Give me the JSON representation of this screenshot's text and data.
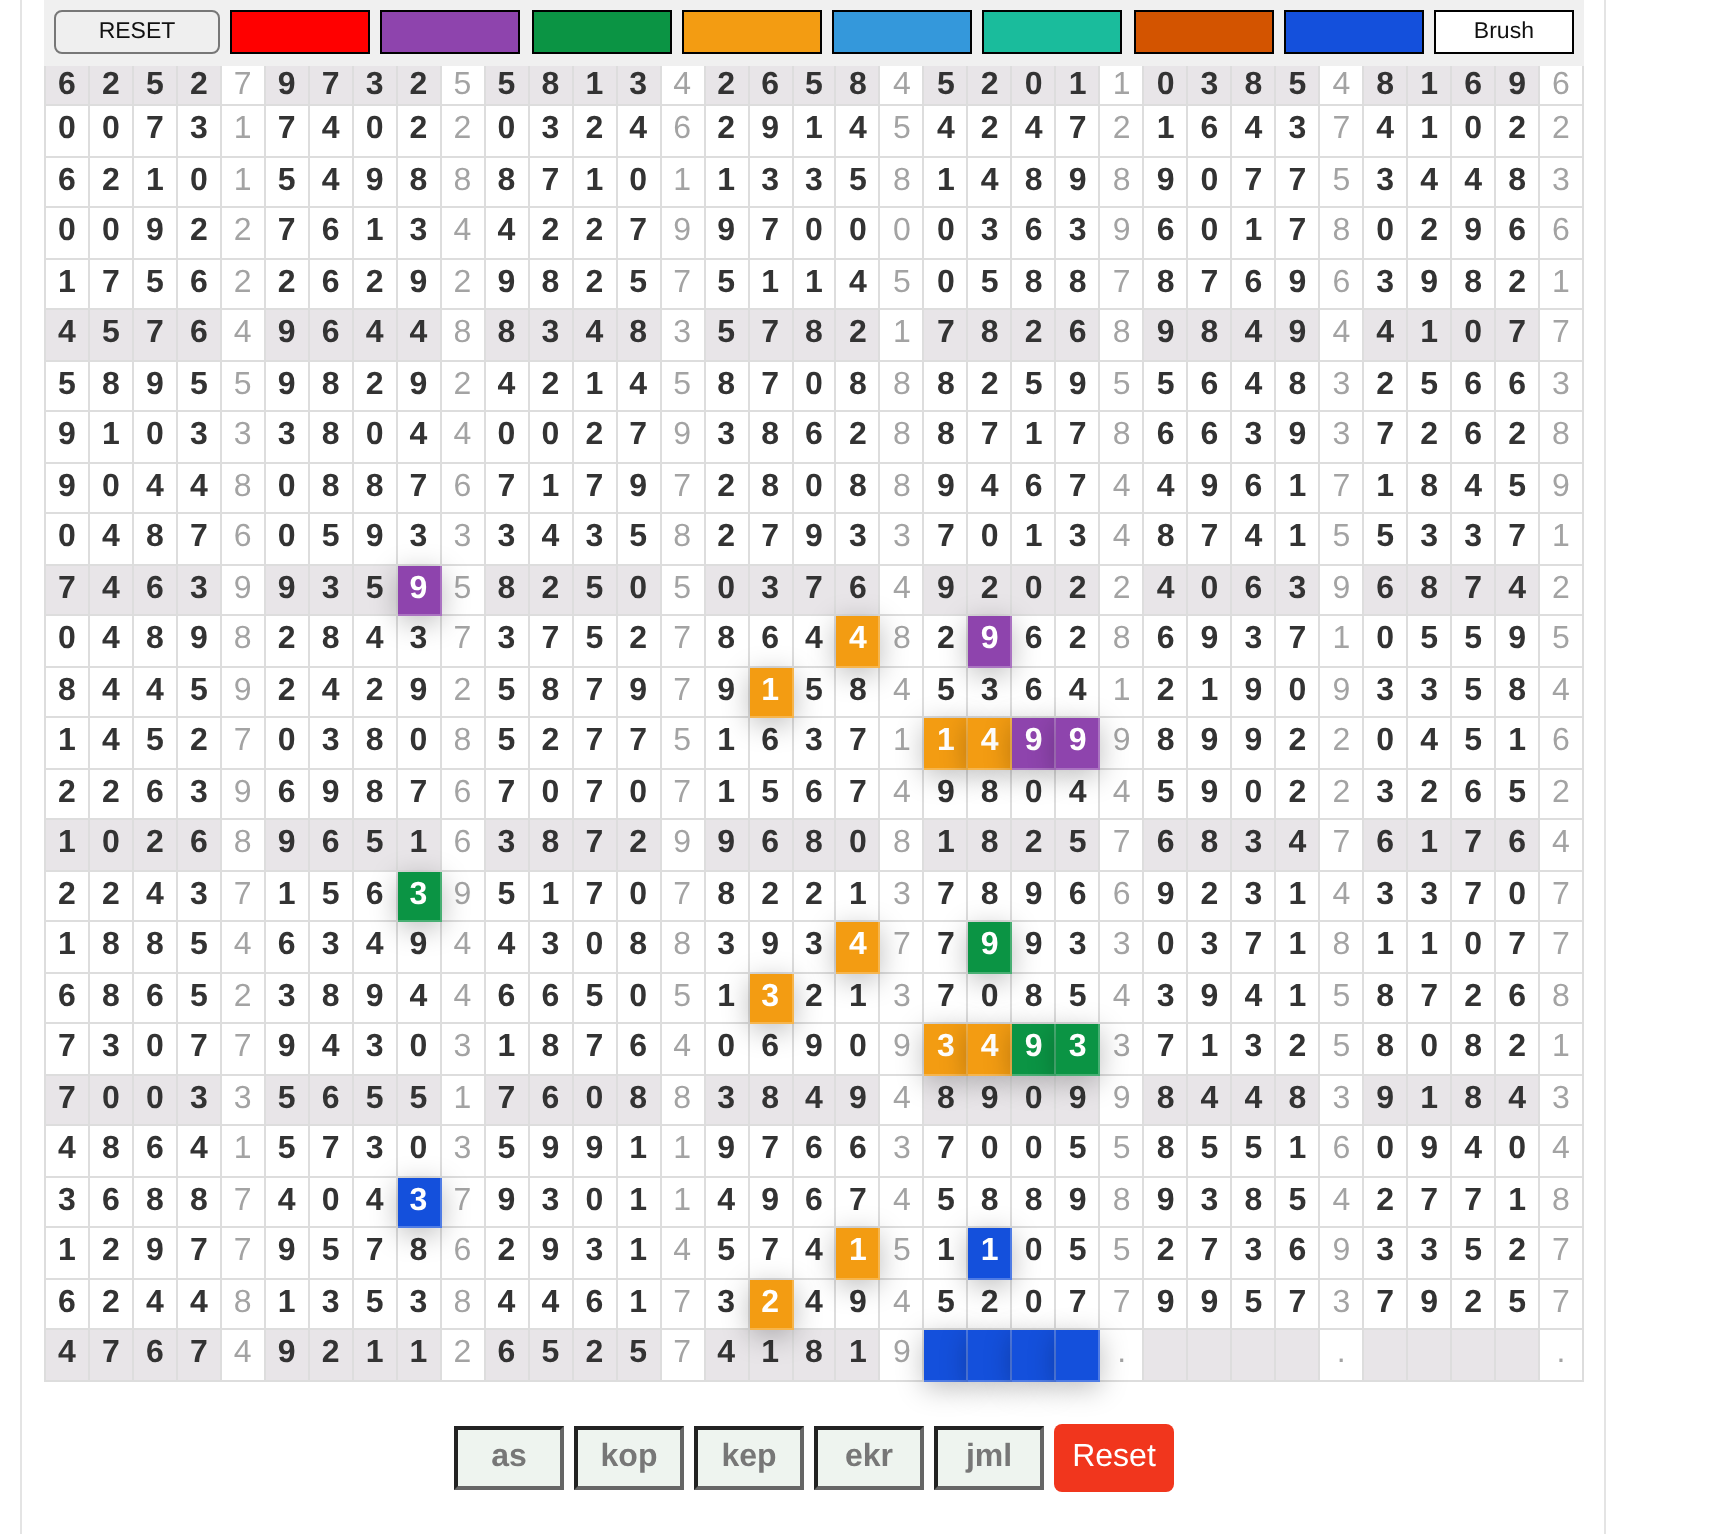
{
  "toolbar": {
    "reset": "RESET",
    "swatches": [
      {
        "color": "#ff0000"
      },
      {
        "color": "#8e44ad"
      },
      {
        "color": "#0b9444"
      },
      {
        "color": "#f39c12"
      },
      {
        "color": "#3498db"
      },
      {
        "color": "#1abc9c"
      },
      {
        "color": "#d35400"
      },
      {
        "color": "#1450dc"
      }
    ],
    "brush": "Brush"
  },
  "grid": {
    "rows": [
      {
        "shaded": true,
        "groups": [
          {
            "digits": [
              "6",
              "2",
              "5",
              "2"
            ],
            "separator": "7"
          },
          {
            "digits": [
              "9",
              "7",
              "3",
              "2"
            ],
            "separator": "5"
          },
          {
            "digits": [
              "5",
              "8",
              "1",
              "3"
            ],
            "separator": "4"
          },
          {
            "digits": [
              "2",
              "6",
              "5",
              "8"
            ],
            "separator": "4"
          },
          {
            "digits": [
              "5",
              "2",
              "0",
              "1"
            ],
            "separator": "1"
          },
          {
            "digits": [
              "0",
              "3",
              "8",
              "5"
            ],
            "separator": "4"
          },
          {
            "digits": [
              "8",
              "1",
              "6",
              "9"
            ],
            "separator": "6"
          }
        ]
      },
      {
        "shaded": false,
        "groups": [
          {
            "digits": [
              "0",
              "0",
              "7",
              "3"
            ],
            "separator": "1"
          },
          {
            "digits": [
              "7",
              "4",
              "0",
              "2"
            ],
            "separator": "2"
          },
          {
            "digits": [
              "0",
              "3",
              "2",
              "4"
            ],
            "separator": "6"
          },
          {
            "digits": [
              "2",
              "9",
              "1",
              "4"
            ],
            "separator": "5"
          },
          {
            "digits": [
              "4",
              "2",
              "4",
              "7"
            ],
            "separator": "2"
          },
          {
            "digits": [
              "1",
              "6",
              "4",
              "3"
            ],
            "separator": "7"
          },
          {
            "digits": [
              "4",
              "1",
              "0",
              "2"
            ],
            "separator": "2"
          }
        ]
      },
      {
        "shaded": false,
        "groups": [
          {
            "digits": [
              "6",
              "2",
              "1",
              "0"
            ],
            "separator": "1"
          },
          {
            "digits": [
              "5",
              "4",
              "9",
              "8"
            ],
            "separator": "8"
          },
          {
            "digits": [
              "8",
              "7",
              "1",
              "0"
            ],
            "separator": "1"
          },
          {
            "digits": [
              "1",
              "3",
              "3",
              "5"
            ],
            "separator": "8"
          },
          {
            "digits": [
              "1",
              "4",
              "8",
              "9"
            ],
            "separator": "8"
          },
          {
            "digits": [
              "9",
              "0",
              "7",
              "7"
            ],
            "separator": "5"
          },
          {
            "digits": [
              "3",
              "4",
              "4",
              "8"
            ],
            "separator": "3"
          }
        ]
      },
      {
        "shaded": false,
        "groups": [
          {
            "digits": [
              "0",
              "0",
              "9",
              "2"
            ],
            "separator": "2"
          },
          {
            "digits": [
              "7",
              "6",
              "1",
              "3"
            ],
            "separator": "4"
          },
          {
            "digits": [
              "4",
              "2",
              "2",
              "7"
            ],
            "separator": "9"
          },
          {
            "digits": [
              "9",
              "7",
              "0",
              "0"
            ],
            "separator": "0"
          },
          {
            "digits": [
              "0",
              "3",
              "6",
              "3"
            ],
            "separator": "9"
          },
          {
            "digits": [
              "6",
              "0",
              "1",
              "7"
            ],
            "separator": "8"
          },
          {
            "digits": [
              "0",
              "2",
              "9",
              "6"
            ],
            "separator": "6"
          }
        ]
      },
      {
        "shaded": false,
        "groups": [
          {
            "digits": [
              "1",
              "7",
              "5",
              "6"
            ],
            "separator": "2"
          },
          {
            "digits": [
              "2",
              "6",
              "2",
              "9"
            ],
            "separator": "2"
          },
          {
            "digits": [
              "9",
              "8",
              "2",
              "5"
            ],
            "separator": "7"
          },
          {
            "digits": [
              "5",
              "1",
              "1",
              "4"
            ],
            "separator": "5"
          },
          {
            "digits": [
              "0",
              "5",
              "8",
              "8"
            ],
            "separator": "7"
          },
          {
            "digits": [
              "8",
              "7",
              "6",
              "9"
            ],
            "separator": "6"
          },
          {
            "digits": [
              "3",
              "9",
              "8",
              "2"
            ],
            "separator": "1"
          }
        ]
      },
      {
        "shaded": true,
        "groups": [
          {
            "digits": [
              "4",
              "5",
              "7",
              "6"
            ],
            "separator": "4"
          },
          {
            "digits": [
              "9",
              "6",
              "4",
              "4"
            ],
            "separator": "8"
          },
          {
            "digits": [
              "8",
              "3",
              "4",
              "8"
            ],
            "separator": "3"
          },
          {
            "digits": [
              "5",
              "7",
              "8",
              "2"
            ],
            "separator": "1"
          },
          {
            "digits": [
              "7",
              "8",
              "2",
              "6"
            ],
            "separator": "8"
          },
          {
            "digits": [
              "9",
              "8",
              "4",
              "9"
            ],
            "separator": "4"
          },
          {
            "digits": [
              "4",
              "1",
              "0",
              "7"
            ],
            "separator": "7"
          }
        ]
      },
      {
        "shaded": false,
        "groups": [
          {
            "digits": [
              "5",
              "8",
              "9",
              "5"
            ],
            "separator": "5"
          },
          {
            "digits": [
              "9",
              "8",
              "2",
              "9"
            ],
            "separator": "2"
          },
          {
            "digits": [
              "4",
              "2",
              "1",
              "4"
            ],
            "separator": "5"
          },
          {
            "digits": [
              "8",
              "7",
              "0",
              "8"
            ],
            "separator": "8"
          },
          {
            "digits": [
              "8",
              "2",
              "5",
              "9"
            ],
            "separator": "5"
          },
          {
            "digits": [
              "5",
              "6",
              "4",
              "8"
            ],
            "separator": "3"
          },
          {
            "digits": [
              "2",
              "5",
              "6",
              "6"
            ],
            "separator": "3"
          }
        ]
      },
      {
        "shaded": false,
        "groups": [
          {
            "digits": [
              "9",
              "1",
              "0",
              "3"
            ],
            "separator": "3"
          },
          {
            "digits": [
              "3",
              "8",
              "0",
              "4"
            ],
            "separator": "4"
          },
          {
            "digits": [
              "0",
              "0",
              "2",
              "7"
            ],
            "separator": "9"
          },
          {
            "digits": [
              "3",
              "8",
              "6",
              "2"
            ],
            "separator": "8"
          },
          {
            "digits": [
              "8",
              "7",
              "1",
              "7"
            ],
            "separator": "8"
          },
          {
            "digits": [
              "6",
              "6",
              "3",
              "9"
            ],
            "separator": "3"
          },
          {
            "digits": [
              "7",
              "2",
              "6",
              "2"
            ],
            "separator": "8"
          }
        ]
      },
      {
        "shaded": false,
        "groups": [
          {
            "digits": [
              "9",
              "0",
              "4",
              "4"
            ],
            "separator": "8"
          },
          {
            "digits": [
              "0",
              "8",
              "8",
              "7"
            ],
            "separator": "6"
          },
          {
            "digits": [
              "7",
              "1",
              "7",
              "9"
            ],
            "separator": "7"
          },
          {
            "digits": [
              "2",
              "8",
              "0",
              "8"
            ],
            "separator": "8"
          },
          {
            "digits": [
              "9",
              "4",
              "6",
              "7"
            ],
            "separator": "4"
          },
          {
            "digits": [
              "4",
              "9",
              "6",
              "1"
            ],
            "separator": "7"
          },
          {
            "digits": [
              "1",
              "8",
              "4",
              "5"
            ],
            "separator": "9"
          }
        ]
      },
      {
        "shaded": false,
        "groups": [
          {
            "digits": [
              "0",
              "4",
              "8",
              "7"
            ],
            "separator": "6"
          },
          {
            "digits": [
              "0",
              "5",
              "9",
              "3"
            ],
            "separator": "3"
          },
          {
            "digits": [
              "3",
              "4",
              "3",
              "5"
            ],
            "separator": "8"
          },
          {
            "digits": [
              "2",
              "7",
              "9",
              "3"
            ],
            "separator": "3"
          },
          {
            "digits": [
              "7",
              "0",
              "1",
              "3"
            ],
            "separator": "4"
          },
          {
            "digits": [
              "8",
              "7",
              "4",
              "1"
            ],
            "separator": "5"
          },
          {
            "digits": [
              "5",
              "3",
              "3",
              "7"
            ],
            "separator": "1"
          }
        ]
      },
      {
        "shaded": true,
        "groups": [
          {
            "digits": [
              "7",
              "4",
              "6",
              "3"
            ],
            "separator": "9"
          },
          {
            "digits": [
              "9",
              "3",
              "5",
              {
                "kind": "painted",
                "digit": "9",
                "color": "#8e44ad"
              }
            ],
            "separator": "5"
          },
          {
            "digits": [
              "8",
              "2",
              "5",
              "0"
            ],
            "separator": "5"
          },
          {
            "digits": [
              "0",
              "3",
              "7",
              "6"
            ],
            "separator": "4"
          },
          {
            "digits": [
              "9",
              "2",
              "0",
              "2"
            ],
            "separator": "2"
          },
          {
            "digits": [
              "4",
              "0",
              "6",
              "3"
            ],
            "separator": "9"
          },
          {
            "digits": [
              "6",
              "8",
              "7",
              "4"
            ],
            "separator": "2"
          }
        ]
      },
      {
        "shaded": false,
        "groups": [
          {
            "digits": [
              "0",
              "4",
              "8",
              "9"
            ],
            "separator": "8"
          },
          {
            "digits": [
              "2",
              "8",
              "4",
              "3"
            ],
            "separator": "7"
          },
          {
            "digits": [
              "3",
              "7",
              "5",
              "2"
            ],
            "separator": "7"
          },
          {
            "digits": [
              "8",
              "6",
              "4",
              {
                "kind": "painted",
                "digit": "4",
                "color": "#f39c12"
              }
            ],
            "separator": "8"
          },
          {
            "digits": [
              "2",
              {
                "kind": "painted",
                "digit": "9",
                "color": "#8e44ad"
              },
              "6",
              "2"
            ],
            "separator": "8"
          },
          {
            "digits": [
              "6",
              "9",
              "3",
              "7"
            ],
            "separator": "1"
          },
          {
            "digits": [
              "0",
              "5",
              "5",
              "9"
            ],
            "separator": "5"
          }
        ]
      },
      {
        "shaded": false,
        "groups": [
          {
            "digits": [
              "8",
              "4",
              "4",
              "5"
            ],
            "separator": "9"
          },
          {
            "digits": [
              "2",
              "4",
              "2",
              "9"
            ],
            "separator": "2"
          },
          {
            "digits": [
              "5",
              "8",
              "7",
              "9"
            ],
            "separator": "7"
          },
          {
            "digits": [
              "9",
              {
                "kind": "painted",
                "digit": "1",
                "color": "#f39c12"
              },
              "5",
              "8"
            ],
            "separator": "4"
          },
          {
            "digits": [
              "5",
              "3",
              "6",
              "4"
            ],
            "separator": "1"
          },
          {
            "digits": [
              "2",
              "1",
              "9",
              "0"
            ],
            "separator": "9"
          },
          {
            "digits": [
              "3",
              "3",
              "5",
              "8"
            ],
            "separator": "4"
          }
        ]
      },
      {
        "shaded": false,
        "groups": [
          {
            "digits": [
              "1",
              "4",
              "5",
              "2"
            ],
            "separator": "7"
          },
          {
            "digits": [
              "0",
              "3",
              "8",
              "0"
            ],
            "separator": "8"
          },
          {
            "digits": [
              "5",
              "2",
              "7",
              "7"
            ],
            "separator": "5"
          },
          {
            "digits": [
              "1",
              "6",
              "3",
              "7"
            ],
            "separator": "1"
          },
          {
            "digits": [
              {
                "kind": "painted",
                "digit": "1",
                "color": "#f39c12"
              },
              {
                "kind": "painted",
                "digit": "4",
                "color": "#f39c12"
              },
              {
                "kind": "painted",
                "digit": "9",
                "color": "#8e44ad"
              },
              {
                "kind": "painted",
                "digit": "9",
                "color": "#8e44ad"
              }
            ],
            "separator": "9"
          },
          {
            "digits": [
              "8",
              "9",
              "9",
              "2"
            ],
            "separator": "2"
          },
          {
            "digits": [
              "0",
              "4",
              "5",
              "1"
            ],
            "separator": "6"
          }
        ]
      },
      {
        "shaded": false,
        "groups": [
          {
            "digits": [
              "2",
              "2",
              "6",
              "3"
            ],
            "separator": "9"
          },
          {
            "digits": [
              "6",
              "9",
              "8",
              "7"
            ],
            "separator": "6"
          },
          {
            "digits": [
              "7",
              "0",
              "7",
              "0"
            ],
            "separator": "7"
          },
          {
            "digits": [
              "1",
              "5",
              "6",
              "7"
            ],
            "separator": "4"
          },
          {
            "digits": [
              "9",
              "8",
              "0",
              "4"
            ],
            "separator": "4"
          },
          {
            "digits": [
              "5",
              "9",
              "0",
              "2"
            ],
            "separator": "2"
          },
          {
            "digits": [
              "3",
              "2",
              "6",
              "5"
            ],
            "separator": "2"
          }
        ]
      },
      {
        "shaded": true,
        "groups": [
          {
            "digits": [
              "1",
              "0",
              "2",
              "6"
            ],
            "separator": "8"
          },
          {
            "digits": [
              "9",
              "6",
              "5",
              "1"
            ],
            "separator": "6"
          },
          {
            "digits": [
              "3",
              "8",
              "7",
              "2"
            ],
            "separator": "9"
          },
          {
            "digits": [
              "9",
              "6",
              "8",
              "0"
            ],
            "separator": "8"
          },
          {
            "digits": [
              "1",
              "8",
              "2",
              "5"
            ],
            "separator": "7"
          },
          {
            "digits": [
              "6",
              "8",
              "3",
              "4"
            ],
            "separator": "7"
          },
          {
            "digits": [
              "6",
              "1",
              "7",
              "6"
            ],
            "separator": "4"
          }
        ]
      },
      {
        "shaded": false,
        "groups": [
          {
            "digits": [
              "2",
              "2",
              "4",
              "3"
            ],
            "separator": "7"
          },
          {
            "digits": [
              "1",
              "5",
              "6",
              {
                "kind": "painted",
                "digit": "3",
                "color": "#0b9444"
              }
            ],
            "separator": "9"
          },
          {
            "digits": [
              "5",
              "1",
              "7",
              "0"
            ],
            "separator": "7"
          },
          {
            "digits": [
              "8",
              "2",
              "2",
              "1"
            ],
            "separator": "3"
          },
          {
            "digits": [
              "7",
              "8",
              "9",
              "6"
            ],
            "separator": "6"
          },
          {
            "digits": [
              "9",
              "2",
              "3",
              "1"
            ],
            "separator": "4"
          },
          {
            "digits": [
              "3",
              "3",
              "7",
              "0"
            ],
            "separator": "7"
          }
        ]
      },
      {
        "shaded": false,
        "groups": [
          {
            "digits": [
              "1",
              "8",
              "8",
              "5"
            ],
            "separator": "4"
          },
          {
            "digits": [
              "6",
              "3",
              "4",
              "9"
            ],
            "separator": "4"
          },
          {
            "digits": [
              "4",
              "3",
              "0",
              "8"
            ],
            "separator": "8"
          },
          {
            "digits": [
              "3",
              "9",
              "3",
              {
                "kind": "painted",
                "digit": "4",
                "color": "#f39c12"
              }
            ],
            "separator": "7"
          },
          {
            "digits": [
              "7",
              {
                "kind": "painted",
                "digit": "9",
                "color": "#0b9444"
              },
              "9",
              "3"
            ],
            "separator": "3"
          },
          {
            "digits": [
              "0",
              "3",
              "7",
              "1"
            ],
            "separator": "8"
          },
          {
            "digits": [
              "1",
              "1",
              "0",
              "7"
            ],
            "separator": "7"
          }
        ]
      },
      {
        "shaded": false,
        "groups": [
          {
            "digits": [
              "6",
              "8",
              "6",
              "5"
            ],
            "separator": "2"
          },
          {
            "digits": [
              "3",
              "8",
              "9",
              "4"
            ],
            "separator": "4"
          },
          {
            "digits": [
              "6",
              "6",
              "5",
              "0"
            ],
            "separator": "5"
          },
          {
            "digits": [
              "1",
              {
                "kind": "painted",
                "digit": "3",
                "color": "#f39c12"
              },
              "2",
              "1"
            ],
            "separator": "3"
          },
          {
            "digits": [
              "7",
              "0",
              "8",
              "5"
            ],
            "separator": "4"
          },
          {
            "digits": [
              "3",
              "9",
              "4",
              "1"
            ],
            "separator": "5"
          },
          {
            "digits": [
              "8",
              "7",
              "2",
              "6"
            ],
            "separator": "8"
          }
        ]
      },
      {
        "shaded": false,
        "groups": [
          {
            "digits": [
              "7",
              "3",
              "0",
              "7"
            ],
            "separator": "7"
          },
          {
            "digits": [
              "9",
              "4",
              "3",
              "0"
            ],
            "separator": "3"
          },
          {
            "digits": [
              "1",
              "8",
              "7",
              "6"
            ],
            "separator": "4"
          },
          {
            "digits": [
              "0",
              "6",
              "9",
              "0"
            ],
            "separator": "9"
          },
          {
            "digits": [
              {
                "kind": "painted",
                "digit": "3",
                "color": "#f39c12"
              },
              {
                "kind": "painted",
                "digit": "4",
                "color": "#f39c12"
              },
              {
                "kind": "painted",
                "digit": "9",
                "color": "#0b9444"
              },
              {
                "kind": "painted",
                "digit": "3",
                "color": "#0b9444"
              }
            ],
            "separator": "3"
          },
          {
            "digits": [
              "7",
              "1",
              "3",
              "2"
            ],
            "separator": "5"
          },
          {
            "digits": [
              "8",
              "0",
              "8",
              "2"
            ],
            "separator": "1"
          }
        ]
      },
      {
        "shaded": true,
        "groups": [
          {
            "digits": [
              "7",
              "0",
              "0",
              "3"
            ],
            "separator": "3"
          },
          {
            "digits": [
              "5",
              "6",
              "5",
              "5"
            ],
            "separator": "1"
          },
          {
            "digits": [
              "7",
              "6",
              "0",
              "8"
            ],
            "separator": "8"
          },
          {
            "digits": [
              "3",
              "8",
              "4",
              "9"
            ],
            "separator": "4"
          },
          {
            "digits": [
              "8",
              "9",
              "0",
              "9"
            ],
            "separator": "9"
          },
          {
            "digits": [
              "8",
              "4",
              "4",
              "8"
            ],
            "separator": "3"
          },
          {
            "digits": [
              "9",
              "1",
              "8",
              "4"
            ],
            "separator": "3"
          }
        ]
      },
      {
        "shaded": false,
        "groups": [
          {
            "digits": [
              "4",
              "8",
              "6",
              "4"
            ],
            "separator": "1"
          },
          {
            "digits": [
              "5",
              "7",
              "3",
              "0"
            ],
            "separator": "3"
          },
          {
            "digits": [
              "5",
              "9",
              "9",
              "1"
            ],
            "separator": "1"
          },
          {
            "digits": [
              "9",
              "7",
              "6",
              "6"
            ],
            "separator": "3"
          },
          {
            "digits": [
              "7",
              "0",
              "0",
              "5"
            ],
            "separator": "5"
          },
          {
            "digits": [
              "8",
              "5",
              "5",
              "1"
            ],
            "separator": "6"
          },
          {
            "digits": [
              "0",
              "9",
              "4",
              "0"
            ],
            "separator": "4"
          }
        ]
      },
      {
        "shaded": false,
        "groups": [
          {
            "digits": [
              "3",
              "6",
              "8",
              "8"
            ],
            "separator": "7"
          },
          {
            "digits": [
              "4",
              "0",
              "4",
              {
                "kind": "painted",
                "digit": "3",
                "color": "#1450dc"
              }
            ],
            "separator": "7"
          },
          {
            "digits": [
              "9",
              "3",
              "0",
              "1"
            ],
            "separator": "1"
          },
          {
            "digits": [
              "4",
              "9",
              "6",
              "7"
            ],
            "separator": "4"
          },
          {
            "digits": [
              "5",
              "8",
              "8",
              "9"
            ],
            "separator": "8"
          },
          {
            "digits": [
              "9",
              "3",
              "8",
              "5"
            ],
            "separator": "4"
          },
          {
            "digits": [
              "2",
              "7",
              "7",
              "1"
            ],
            "separator": "8"
          }
        ]
      },
      {
        "shaded": false,
        "groups": [
          {
            "digits": [
              "1",
              "2",
              "9",
              "7"
            ],
            "separator": "7"
          },
          {
            "digits": [
              "9",
              "5",
              "7",
              "8"
            ],
            "separator": "6"
          },
          {
            "digits": [
              "2",
              "9",
              "3",
              "1"
            ],
            "separator": "4"
          },
          {
            "digits": [
              "5",
              "7",
              "4",
              {
                "kind": "painted",
                "digit": "1",
                "color": "#f39c12"
              }
            ],
            "separator": "5"
          },
          {
            "digits": [
              "1",
              {
                "kind": "painted",
                "digit": "1",
                "color": "#1450dc"
              },
              "0",
              "5"
            ],
            "separator": "5"
          },
          {
            "digits": [
              "2",
              "7",
              "3",
              "6"
            ],
            "separator": "9"
          },
          {
            "digits": [
              "3",
              "3",
              "5",
              "2"
            ],
            "separator": "7"
          }
        ]
      },
      {
        "shaded": false,
        "groups": [
          {
            "digits": [
              "6",
              "2",
              "4",
              "4"
            ],
            "separator": "8"
          },
          {
            "digits": [
              "1",
              "3",
              "5",
              "3"
            ],
            "separator": "8"
          },
          {
            "digits": [
              "4",
              "4",
              "6",
              "1"
            ],
            "separator": "7"
          },
          {
            "digits": [
              "3",
              {
                "kind": "painted",
                "digit": "2",
                "color": "#f39c12"
              },
              "4",
              "9"
            ],
            "separator": "4"
          },
          {
            "digits": [
              "5",
              "2",
              "0",
              "7"
            ],
            "separator": "7"
          },
          {
            "digits": [
              "9",
              "9",
              "5",
              "7"
            ],
            "separator": "3"
          },
          {
            "digits": [
              "7",
              "9",
              "2",
              "5"
            ],
            "separator": "7"
          }
        ]
      },
      {
        "shaded": true,
        "groups": [
          {
            "digits": [
              "4",
              "7",
              "6",
              "7"
            ],
            "separator": "4"
          },
          {
            "digits": [
              "9",
              "2",
              "1",
              "1"
            ],
            "separator": "2"
          },
          {
            "digits": [
              "6",
              "5",
              "2",
              "5"
            ],
            "separator": "7"
          },
          {
            "digits": [
              "4",
              "1",
              "8",
              "1"
            ],
            "separator": "9"
          },
          {
            "digits": [
              {
                "kind": "painted",
                "color": "#1450dc"
              },
              {
                "kind": "painted",
                "color": "#1450dc"
              },
              {
                "kind": "painted",
                "color": "#1450dc"
              },
              {
                "kind": "painted",
                "color": "#1450dc"
              }
            ],
            "separator": "."
          },
          {
            "digits": [
              {
                "kind": "blank"
              },
              {
                "kind": "blank"
              },
              {
                "kind": "blank"
              },
              {
                "kind": "blank"
              }
            ],
            "separator": "."
          },
          {
            "digits": [
              {
                "kind": "blank"
              },
              {
                "kind": "blank"
              },
              {
                "kind": "blank"
              },
              {
                "kind": "blank"
              }
            ],
            "separator": "."
          }
        ]
      }
    ]
  },
  "actions": {
    "buttons": [
      "as",
      "kop",
      "kep",
      "ekr",
      "jml"
    ],
    "reset": "Reset"
  }
}
